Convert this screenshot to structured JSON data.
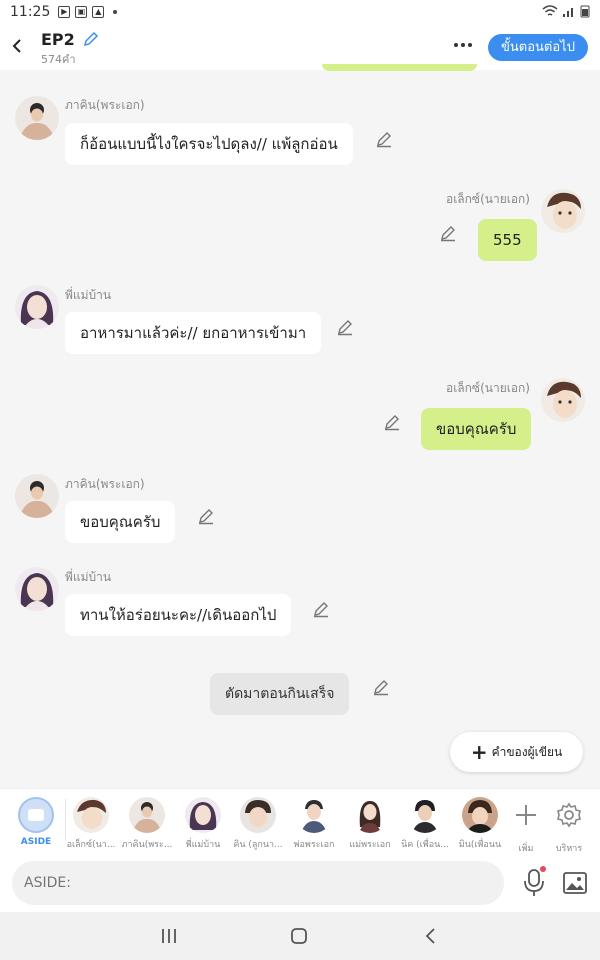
{
  "status_bar": {
    "time": "11:25"
  },
  "header": {
    "title": "EP2",
    "subtitle": "574คำ",
    "next_button": "ขั้นตอนต่อไป"
  },
  "messages": [
    {
      "speaker": "ภาคิน(พระเอก)",
      "text": "ก็อ้อนแบบนี้ไงใครจะไปดุลง// แพ้ลูกอ่อน",
      "side": "left"
    },
    {
      "speaker": "อเล็กซ์(นายเอก)",
      "text": "555",
      "side": "right"
    },
    {
      "speaker": "พี่แม่บ้าน",
      "text": "อาหารมาแล้วค่ะ// ยกอาหารเข้ามา",
      "side": "left"
    },
    {
      "speaker": "อเล็กซ์(นายเอก)",
      "text": "ขอบคุณครับ",
      "side": "right"
    },
    {
      "speaker": "ภาคิน(พระเอก)",
      "text": "ขอบคุณครับ",
      "side": "left"
    },
    {
      "speaker": "พี่แม่บ้าน",
      "text": "ทานให้อร่อยนะคะ//เดินออกไป",
      "side": "left"
    },
    {
      "speaker": "",
      "text": "ตัดมาตอนกินเสร็จ",
      "side": "narration"
    }
  ],
  "fab": {
    "label": "คำของผู้เขียน"
  },
  "character_bar": {
    "aside_label": "ASIDE",
    "characters": [
      "อเล็กซ์(นา...",
      "ภาคิน(พระ...",
      "พี่แม่บ้าน",
      "คิน (ลูกนา...",
      "พ่อพระเอก",
      "แม่พระเอก",
      "นิค (เพื่อน...",
      "มิน(เพื่อนน"
    ],
    "add_label": "เพิ่ม",
    "manage_label": "บริหาร"
  },
  "input": {
    "placeholder": "ASIDE:"
  },
  "colors": {
    "accent": "#3b8ef0",
    "bubble_right": "#d5f08a",
    "bubble_left": "#ffffff",
    "narration": "#e6e6e7"
  }
}
